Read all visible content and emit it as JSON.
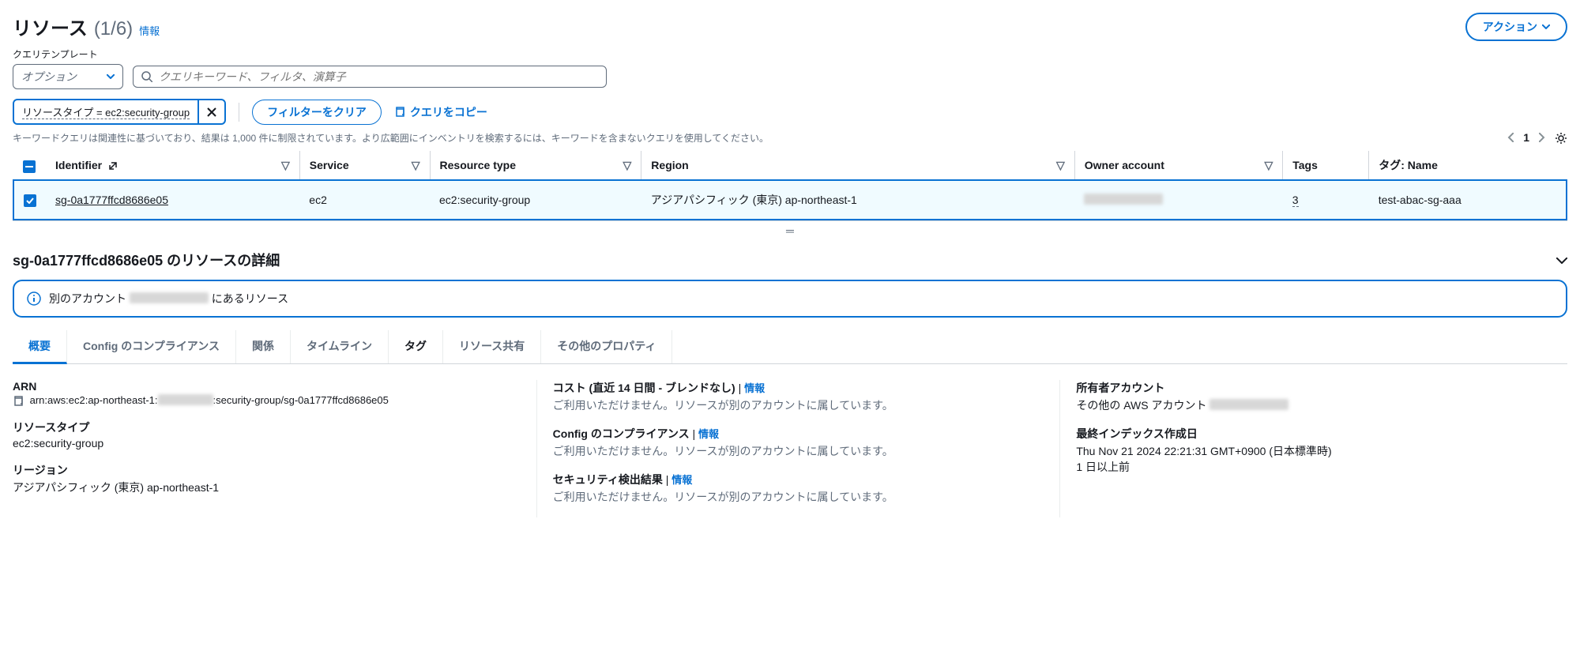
{
  "header": {
    "title": "リソース",
    "count": "(1/6)",
    "info": "情報",
    "action": "アクション"
  },
  "query": {
    "template_label": "クエリテンプレート",
    "template_placeholder": "オプション",
    "search_placeholder": "クエリキーワード、フィルタ、演算子"
  },
  "filter": {
    "chip_text": "リソースタイプ = ec2:security-group",
    "clear": "フィルターをクリア",
    "copy": "クエリをコピー"
  },
  "hint": "キーワードクエリは関連性に基づいており、結果は 1,000 件に制限されています。より広範囲にインベントリを検索するには、キーワードを含まないクエリを使用してください。",
  "pager": {
    "page": "1"
  },
  "table": {
    "headers": {
      "identifier": "Identifier",
      "service": "Service",
      "resource_type": "Resource type",
      "region": "Region",
      "owner": "Owner account",
      "tags": "Tags",
      "tag_name": "タグ: Name"
    },
    "rows": [
      {
        "identifier": "sg-0a1777ffcd8686e05",
        "service": "ec2",
        "resource_type": "ec2:security-group",
        "region": "アジアパシフィック (東京) ap-northeast-1",
        "owner": "████████████",
        "tags": "3",
        "tag_name": "test-abac-sg-aaa"
      }
    ]
  },
  "detail": {
    "title_prefix": "sg-0a1777ffcd8686e05",
    "title_suffix": " のリソースの詳細",
    "info_prefix": "別のアカウント ",
    "info_suffix": " にあるリソース",
    "tabs": {
      "overview": "概要",
      "config": "Config のコンプライアンス",
      "relations": "関係",
      "timeline": "タイムライン",
      "tags": "タグ",
      "sharing": "リソース共有",
      "other": "その他のプロパティ"
    },
    "col1": {
      "arn_label": "ARN",
      "arn_pre": "arn:aws:ec2:ap-northeast-1:",
      "arn_post": ":security-group/sg-0a1777ffcd8686e05",
      "rtype_label": "リソースタイプ",
      "rtype_value": "ec2:security-group",
      "region_label": "リージョン",
      "region_value": "アジアパシフィック (東京) ap-northeast-1"
    },
    "col2": {
      "cost_label": "コスト (直近 14 日間 - ブレンドなし)",
      "info": "情報",
      "unavailable": "ご利用いただけません。リソースが別のアカウントに属しています。",
      "config_label": "Config のコンプライアンス",
      "security_label": "セキュリティ検出結果"
    },
    "col3": {
      "owner_label": "所有者アカウント",
      "owner_value": "その他の AWS アカウント ",
      "index_label": "最終インデックス作成日",
      "index_value": "Thu Nov 21 2024 22:21:31 GMT+0900 (日本標準時)",
      "index_rel": "1 日以上前"
    }
  }
}
